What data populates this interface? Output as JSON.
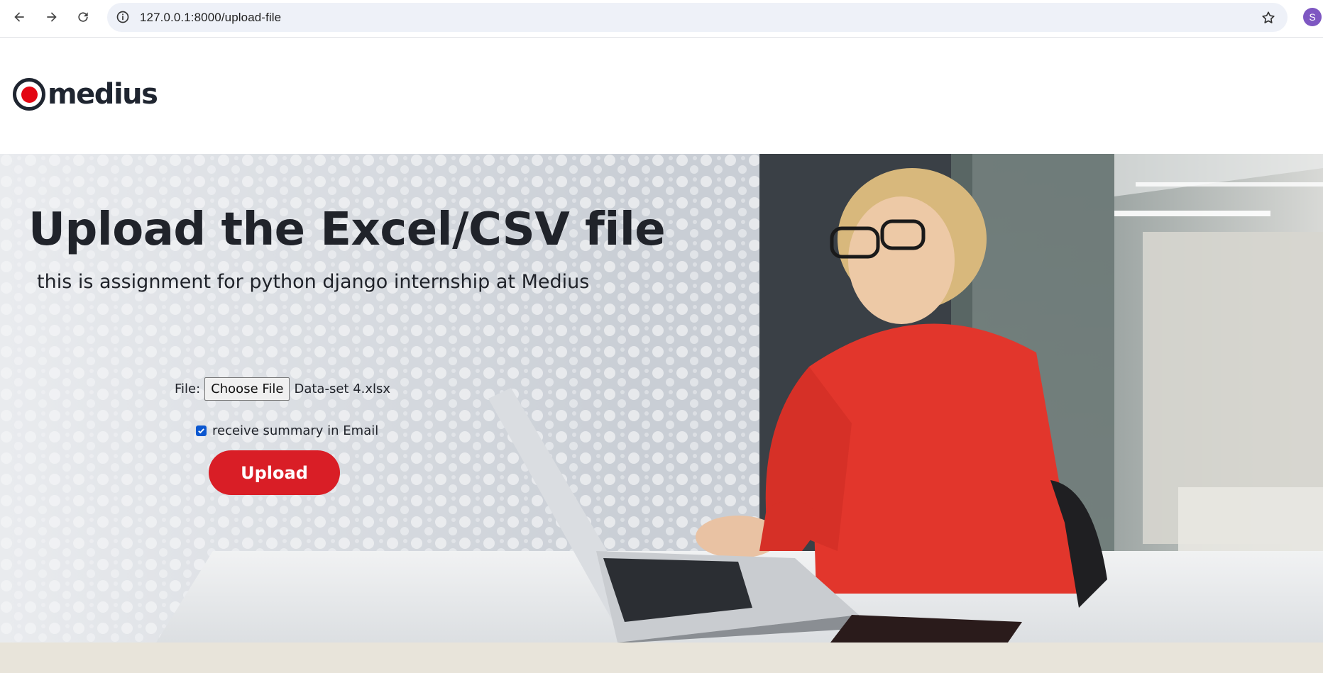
{
  "browser": {
    "url": "127.0.0.1:8000/upload-file",
    "profile_initial": "S"
  },
  "header": {
    "logo_text": "medius"
  },
  "hero": {
    "title": "Upload the Excel/CSV file",
    "subtitle": "this is assignment for python django internship at Medius"
  },
  "form": {
    "file_label": "File:",
    "choose_file_label": "Choose File",
    "selected_file": "Data-set 4.xlsx",
    "email_checkbox_label": "receive summary in Email",
    "email_checkbox_checked": true,
    "upload_label": "Upload"
  },
  "colors": {
    "brand_red": "#d91e26",
    "logo_dark": "#1f2530",
    "checkbox_blue": "#0b57d0"
  }
}
